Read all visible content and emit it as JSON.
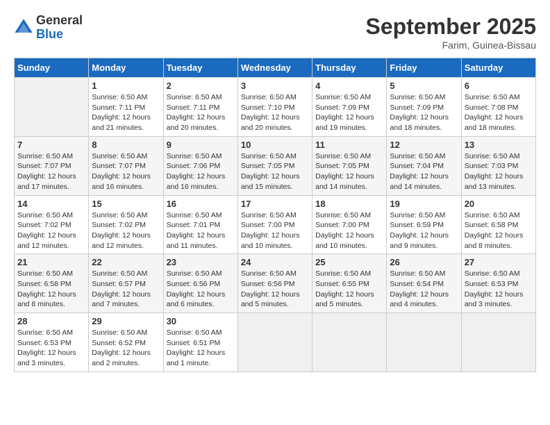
{
  "header": {
    "logo_general": "General",
    "logo_blue": "Blue",
    "month_title": "September 2025",
    "location": "Farim, Guinea-Bissau"
  },
  "days_of_week": [
    "Sunday",
    "Monday",
    "Tuesday",
    "Wednesday",
    "Thursday",
    "Friday",
    "Saturday"
  ],
  "weeks": [
    [
      {
        "day": "",
        "info": ""
      },
      {
        "day": "1",
        "info": "Sunrise: 6:50 AM\nSunset: 7:11 PM\nDaylight: 12 hours\nand 21 minutes."
      },
      {
        "day": "2",
        "info": "Sunrise: 6:50 AM\nSunset: 7:11 PM\nDaylight: 12 hours\nand 20 minutes."
      },
      {
        "day": "3",
        "info": "Sunrise: 6:50 AM\nSunset: 7:10 PM\nDaylight: 12 hours\nand 20 minutes."
      },
      {
        "day": "4",
        "info": "Sunrise: 6:50 AM\nSunset: 7:09 PM\nDaylight: 12 hours\nand 19 minutes."
      },
      {
        "day": "5",
        "info": "Sunrise: 6:50 AM\nSunset: 7:09 PM\nDaylight: 12 hours\nand 18 minutes."
      },
      {
        "day": "6",
        "info": "Sunrise: 6:50 AM\nSunset: 7:08 PM\nDaylight: 12 hours\nand 18 minutes."
      }
    ],
    [
      {
        "day": "7",
        "info": "Sunrise: 6:50 AM\nSunset: 7:07 PM\nDaylight: 12 hours\nand 17 minutes."
      },
      {
        "day": "8",
        "info": "Sunrise: 6:50 AM\nSunset: 7:07 PM\nDaylight: 12 hours\nand 16 minutes."
      },
      {
        "day": "9",
        "info": "Sunrise: 6:50 AM\nSunset: 7:06 PM\nDaylight: 12 hours\nand 16 minutes."
      },
      {
        "day": "10",
        "info": "Sunrise: 6:50 AM\nSunset: 7:05 PM\nDaylight: 12 hours\nand 15 minutes."
      },
      {
        "day": "11",
        "info": "Sunrise: 6:50 AM\nSunset: 7:05 PM\nDaylight: 12 hours\nand 14 minutes."
      },
      {
        "day": "12",
        "info": "Sunrise: 6:50 AM\nSunset: 7:04 PM\nDaylight: 12 hours\nand 14 minutes."
      },
      {
        "day": "13",
        "info": "Sunrise: 6:50 AM\nSunset: 7:03 PM\nDaylight: 12 hours\nand 13 minutes."
      }
    ],
    [
      {
        "day": "14",
        "info": "Sunrise: 6:50 AM\nSunset: 7:02 PM\nDaylight: 12 hours\nand 12 minutes."
      },
      {
        "day": "15",
        "info": "Sunrise: 6:50 AM\nSunset: 7:02 PM\nDaylight: 12 hours\nand 12 minutes."
      },
      {
        "day": "16",
        "info": "Sunrise: 6:50 AM\nSunset: 7:01 PM\nDaylight: 12 hours\nand 11 minutes."
      },
      {
        "day": "17",
        "info": "Sunrise: 6:50 AM\nSunset: 7:00 PM\nDaylight: 12 hours\nand 10 minutes."
      },
      {
        "day": "18",
        "info": "Sunrise: 6:50 AM\nSunset: 7:00 PM\nDaylight: 12 hours\nand 10 minutes."
      },
      {
        "day": "19",
        "info": "Sunrise: 6:50 AM\nSunset: 6:59 PM\nDaylight: 12 hours\nand 9 minutes."
      },
      {
        "day": "20",
        "info": "Sunrise: 6:50 AM\nSunset: 6:58 PM\nDaylight: 12 hours\nand 8 minutes."
      }
    ],
    [
      {
        "day": "21",
        "info": "Sunrise: 6:50 AM\nSunset: 6:58 PM\nDaylight: 12 hours\nand 8 minutes."
      },
      {
        "day": "22",
        "info": "Sunrise: 6:50 AM\nSunset: 6:57 PM\nDaylight: 12 hours\nand 7 minutes."
      },
      {
        "day": "23",
        "info": "Sunrise: 6:50 AM\nSunset: 6:56 PM\nDaylight: 12 hours\nand 6 minutes."
      },
      {
        "day": "24",
        "info": "Sunrise: 6:50 AM\nSunset: 6:56 PM\nDaylight: 12 hours\nand 5 minutes."
      },
      {
        "day": "25",
        "info": "Sunrise: 6:50 AM\nSunset: 6:55 PM\nDaylight: 12 hours\nand 5 minutes."
      },
      {
        "day": "26",
        "info": "Sunrise: 6:50 AM\nSunset: 6:54 PM\nDaylight: 12 hours\nand 4 minutes."
      },
      {
        "day": "27",
        "info": "Sunrise: 6:50 AM\nSunset: 6:53 PM\nDaylight: 12 hours\nand 3 minutes."
      }
    ],
    [
      {
        "day": "28",
        "info": "Sunrise: 6:50 AM\nSunset: 6:53 PM\nDaylight: 12 hours\nand 3 minutes."
      },
      {
        "day": "29",
        "info": "Sunrise: 6:50 AM\nSunset: 6:52 PM\nDaylight: 12 hours\nand 2 minutes."
      },
      {
        "day": "30",
        "info": "Sunrise: 6:50 AM\nSunset: 6:51 PM\nDaylight: 12 hours\nand 1 minute."
      },
      {
        "day": "",
        "info": ""
      },
      {
        "day": "",
        "info": ""
      },
      {
        "day": "",
        "info": ""
      },
      {
        "day": "",
        "info": ""
      }
    ]
  ]
}
